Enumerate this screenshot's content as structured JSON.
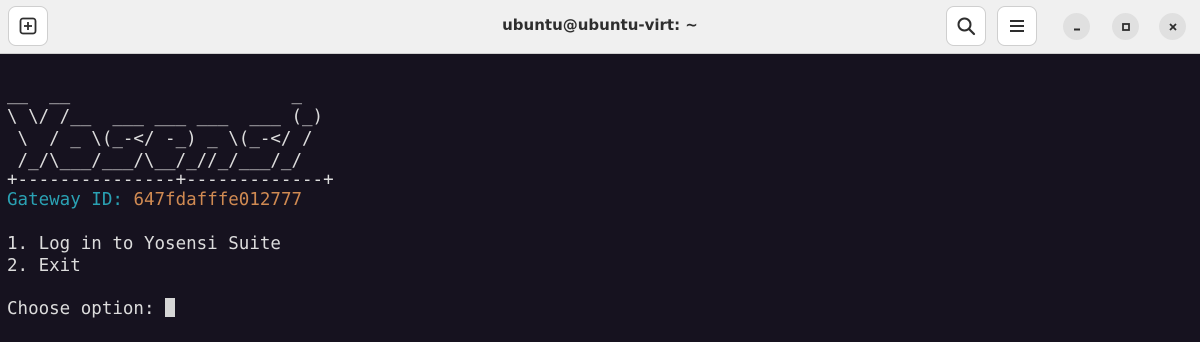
{
  "window": {
    "title": "ubuntu@ubuntu-virt: ~"
  },
  "toolbar": {
    "icons": [
      "new-tab-icon",
      "search-icon",
      "hamburger-menu-icon",
      "minimize-icon",
      "maximize-icon",
      "close-icon"
    ]
  },
  "colors": {
    "terminal_bg": "#16121f",
    "text": "#dcdcdc",
    "label": "#2aa1b3",
    "value": "#d08a52"
  },
  "terminal": {
    "banner": [
      "__  __                     _",
      "\\ \\/ /__  ___ ___ ___  ___ (_)",
      " \\  / _ \\(_-</ -_) _ \\(_-</ /",
      " /_/\\___/___/\\__/_//_/___/_/"
    ],
    "separator": "+---------------+-------------+",
    "gateway_label": "Gateway ID: ",
    "gateway_id": "647fdafffe012777",
    "menu": [
      "1. Log in to Yosensi Suite",
      "2. Exit"
    ],
    "prompt": "Choose option: "
  }
}
